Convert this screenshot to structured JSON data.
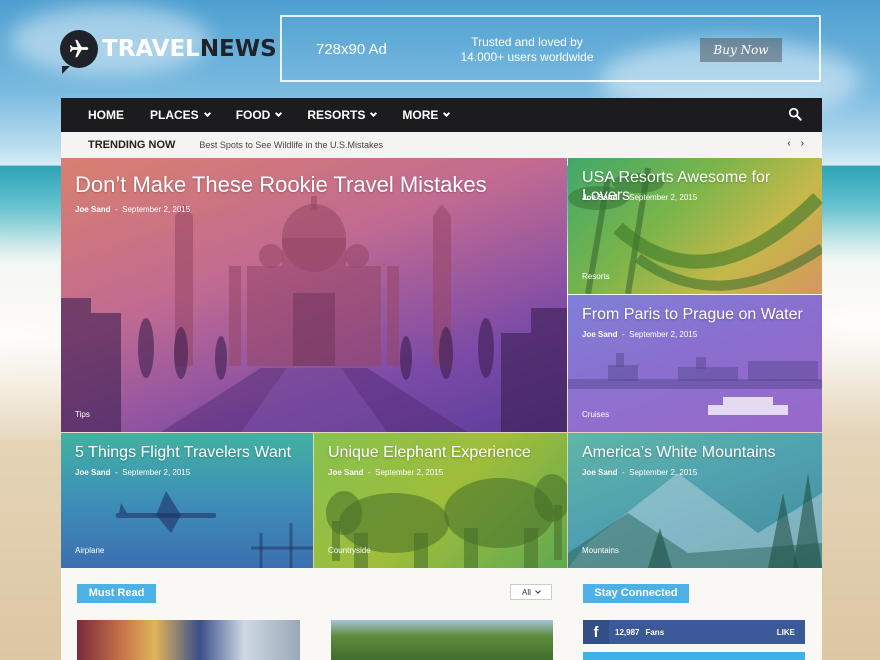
{
  "header": {
    "logo_part1": "TRAVEL",
    "logo_part2": "NEWS",
    "logo_icon": "airplane-icon",
    "ad": {
      "size_label": "728x90 Ad",
      "trust_line1": "Trusted and loved by",
      "trust_line2": "14.000+ users worldwide",
      "buy_label": "Buy Now"
    }
  },
  "nav": {
    "items": [
      {
        "label": "HOME",
        "dropdown": false
      },
      {
        "label": "PLACES",
        "dropdown": true
      },
      {
        "label": "FOOD",
        "dropdown": true
      },
      {
        "label": "RESORTS",
        "dropdown": true
      },
      {
        "label": "MORE",
        "dropdown": true
      }
    ],
    "search_icon": "search-icon"
  },
  "trending": {
    "label": "TRENDING NOW",
    "text": "Best Spots to See Wildlife in the U.S.Mistakes",
    "prev": "‹",
    "next": "›"
  },
  "tiles": [
    {
      "title": "Don’t Make These Rookie Travel Mistakes",
      "author": "Joe Sand",
      "date": "September 2, 2015",
      "category": "Tips"
    },
    {
      "title": "USA Resorts Awesome for Lovers",
      "author": "Joe Sand",
      "date": "September 2, 2015",
      "category": "Resorts"
    },
    {
      "title": "From Paris to Prague on Water",
      "author": "Joe Sand",
      "date": "September 2, 2015",
      "category": "Cruises"
    },
    {
      "title": "5 Things Flight Travelers Want",
      "author": "Joe Sand",
      "date": "September 2, 2015",
      "category": "Airplane"
    },
    {
      "title": "Unique Elephant Experience",
      "author": "Joe Sand",
      "date": "September 2, 2015",
      "category": "Countryside"
    },
    {
      "title": "America’s White Mountains",
      "author": "Joe Sand",
      "date": "September 2, 2015",
      "category": "Mountains"
    }
  ],
  "content": {
    "must_read": "Must Read",
    "filter_value": "All",
    "stay_connected": "Stay Connected",
    "facebook": {
      "count": "12,987",
      "label": "Fans",
      "action": "LIKE",
      "icon": "f"
    }
  },
  "colors": {
    "navbar": "#1c1c1e",
    "accent": "#4db0e6",
    "facebook": "#3b5998",
    "twitter": "#3eb1e8"
  }
}
